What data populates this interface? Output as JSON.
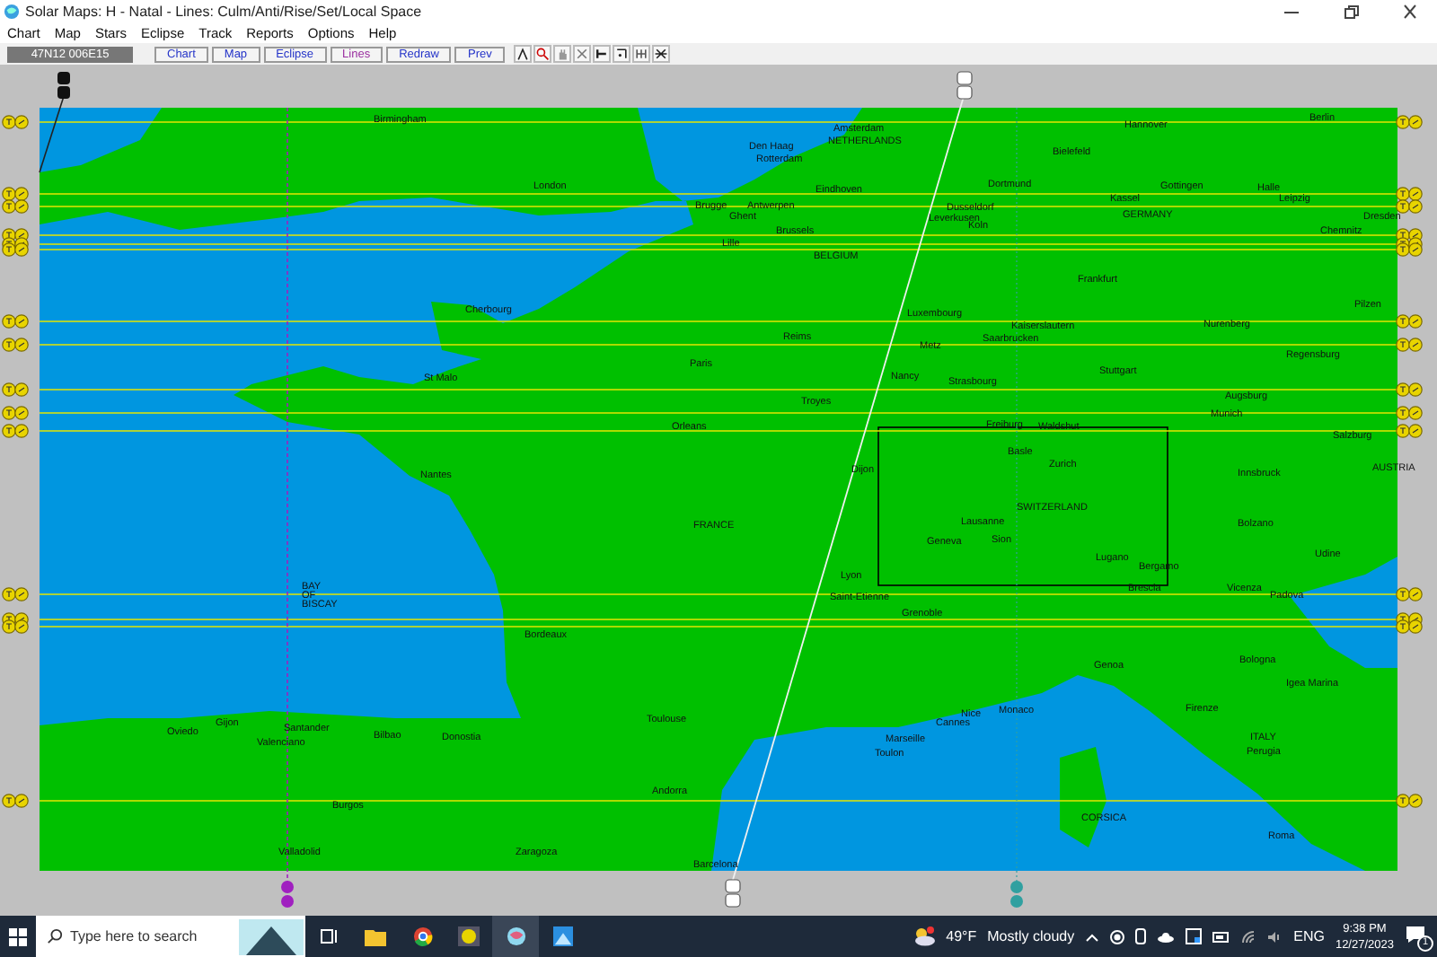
{
  "window": {
    "title": "Solar Maps: H - Natal - Lines: Culm/Anti/Rise/Set/Local Space"
  },
  "menu": [
    "Chart",
    "Map",
    "Stars",
    "Eclipse",
    "Track",
    "Reports",
    "Options",
    "Help"
  ],
  "toolbar": {
    "coordinates": "47N12  006E15",
    "buttons": [
      {
        "label": "Chart",
        "selected": false
      },
      {
        "label": "Map",
        "selected": false
      },
      {
        "label": "Eclipse",
        "selected": false
      },
      {
        "label": "Lines",
        "selected": true
      },
      {
        "label": "Redraw",
        "selected": false
      },
      {
        "label": "Prev",
        "selected": false
      }
    ]
  },
  "map": {
    "places": [
      {
        "name": "Birmingham"
      },
      {
        "name": "London"
      },
      {
        "name": "Den Haag"
      },
      {
        "name": "Rotterdam"
      },
      {
        "name": "Amsterdam"
      },
      {
        "name": "NETHERLANDS"
      },
      {
        "name": "Hannover"
      },
      {
        "name": "Berlin"
      },
      {
        "name": "Bielefeld"
      },
      {
        "name": "Eindhoven"
      },
      {
        "name": "Dortmund"
      },
      {
        "name": "Gottingen"
      },
      {
        "name": "Halle"
      },
      {
        "name": "Kassel"
      },
      {
        "name": "Leipzig"
      },
      {
        "name": "Brugge"
      },
      {
        "name": "Antwerpen"
      },
      {
        "name": "Ghent"
      },
      {
        "name": "Dusseldorf"
      },
      {
        "name": "Leverkusen"
      },
      {
        "name": "Koln"
      },
      {
        "name": "GERMANY"
      },
      {
        "name": "Dresden"
      },
      {
        "name": "Brussels"
      },
      {
        "name": "Lille"
      },
      {
        "name": "Chemnitz"
      },
      {
        "name": "BELGIUM"
      },
      {
        "name": "Frankfurt"
      },
      {
        "name": "Cherbourg"
      },
      {
        "name": "Luxembourg"
      },
      {
        "name": "Pilzen"
      },
      {
        "name": "Kaiserslautern"
      },
      {
        "name": "Nurenberg"
      },
      {
        "name": "Reims"
      },
      {
        "name": "Metz"
      },
      {
        "name": "Saarbrucken"
      },
      {
        "name": "Paris"
      },
      {
        "name": "Regensburg"
      },
      {
        "name": "Nancy"
      },
      {
        "name": "Stuttgart"
      },
      {
        "name": "St Malo"
      },
      {
        "name": "Strasbourg"
      },
      {
        "name": "Augsburg"
      },
      {
        "name": "Troyes"
      },
      {
        "name": "Munich"
      },
      {
        "name": "Orleans"
      },
      {
        "name": "Freiburg"
      },
      {
        "name": "Waldshut"
      },
      {
        "name": "Salzburg"
      },
      {
        "name": "Nantes"
      },
      {
        "name": "Dijon"
      },
      {
        "name": "Basle"
      },
      {
        "name": "Zurich"
      },
      {
        "name": "Innsbruck"
      },
      {
        "name": "AUSTRIA"
      },
      {
        "name": "FRANCE"
      },
      {
        "name": "SWITZERLAND"
      },
      {
        "name": "Lausanne"
      },
      {
        "name": "Bolzano"
      },
      {
        "name": "Geneva"
      },
      {
        "name": "Sion"
      },
      {
        "name": "Lugano"
      },
      {
        "name": "Udine"
      },
      {
        "name": "Bergamo"
      },
      {
        "name": "BAY"
      },
      {
        "name": "OF"
      },
      {
        "name": "BISCAY"
      },
      {
        "name": "Lyon"
      },
      {
        "name": "Saint-Etienne"
      },
      {
        "name": "Brescia"
      },
      {
        "name": "Vicenza"
      },
      {
        "name": "Padova"
      },
      {
        "name": "Grenoble"
      },
      {
        "name": "Bordeaux"
      },
      {
        "name": "Genoa"
      },
      {
        "name": "Bologna"
      },
      {
        "name": "Nice"
      },
      {
        "name": "Monaco"
      },
      {
        "name": "Igea Marina"
      },
      {
        "name": "Toulouse"
      },
      {
        "name": "Oviedo"
      },
      {
        "name": "Gijon"
      },
      {
        "name": "Santander"
      },
      {
        "name": "Bilbao"
      },
      {
        "name": "Donostia"
      },
      {
        "name": "Valenciano"
      },
      {
        "name": "Cannes"
      },
      {
        "name": "Marseille"
      },
      {
        "name": "Toulon"
      },
      {
        "name": "Firenze"
      },
      {
        "name": "ITALY"
      },
      {
        "name": "Perugia"
      },
      {
        "name": "Andorra"
      },
      {
        "name": "CORSICA"
      },
      {
        "name": "Burgos"
      },
      {
        "name": "Zaragoza"
      },
      {
        "name": "Valladolid"
      },
      {
        "name": "Roma"
      },
      {
        "name": "Barcelona"
      }
    ]
  },
  "taskbar": {
    "search": {
      "placeholder": "Type here to search"
    },
    "weather": {
      "temperature": "49°F",
      "condition": "Mostly cloudy"
    },
    "language": "ENG",
    "time": "9:38 PM",
    "date": "12/27/2023",
    "notifications": "1"
  }
}
